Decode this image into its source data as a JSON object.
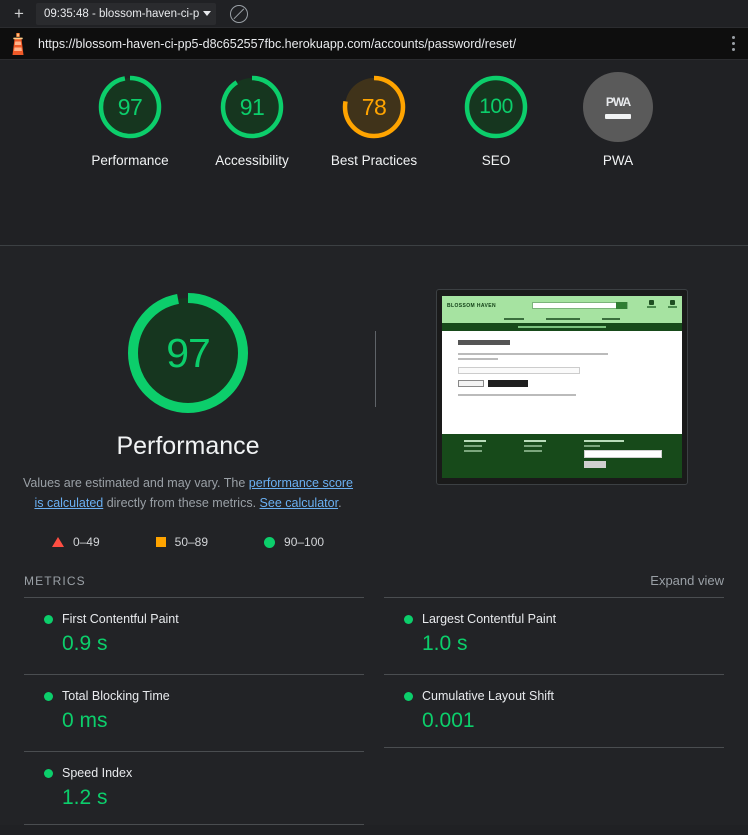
{
  "tabstrip": {
    "new_tab_label": "+",
    "report_tab_label": "09:35:48 - blossom-haven-ci-p",
    "clear_icon": "no-entry-icon"
  },
  "urlbar": {
    "brand_icon": "lighthouse-icon",
    "url": "https://blossom-haven-ci-pp5-d8c652557fbc.herokuapp.com/accounts/password/reset/",
    "menu_icon": "kebab-menu-icon"
  },
  "colors": {
    "pass": "#0cce6b",
    "average": "#ffa400",
    "fail": "#ff4e42",
    "pwa_gray": "#5a5a5a",
    "link": "#6ab0f3",
    "background": "#202124",
    "body_background": "#222326"
  },
  "gauges": [
    {
      "score": "97",
      "label": "Performance",
      "pct": 97,
      "color": "#0cce6b",
      "track": "#16361f"
    },
    {
      "score": "91",
      "label": "Accessibility",
      "pct": 91,
      "color": "#0cce6b",
      "track": "#16361f"
    },
    {
      "score": "78",
      "label": "Best Practices",
      "pct": 78,
      "color": "#ffa400",
      "track": "#40331a"
    },
    {
      "score": "100",
      "label": "SEO",
      "pct": 100,
      "color": "#0cce6b",
      "track": "#16361f"
    },
    {
      "score": "",
      "label": "PWA",
      "pct": 0,
      "color": "#5a5a5a",
      "track": "#5a5a5a"
    }
  ],
  "hero": {
    "score": "97",
    "score_pct": 97,
    "title": "Performance",
    "desc_part1": "Values are estimated and may vary. The ",
    "desc_link1": "performance score is calculated",
    "desc_part2": " directly from these metrics. ",
    "desc_link2": "See calculator",
    "desc_part3": ".",
    "legend": [
      {
        "icon": "triangle-fail-icon",
        "range": "0–49"
      },
      {
        "icon": "square-average-icon",
        "range": "50–89"
      },
      {
        "icon": "circle-pass-icon",
        "range": "90–100"
      }
    ]
  },
  "thumbnail": {
    "name": "page-screenshot-thumbnail",
    "site_name": "BLOSSOM HAVEN",
    "page_heading": "PASSWORD RESET"
  },
  "metrics": {
    "section_title": "METRICS",
    "expand_label": "Expand view",
    "left": [
      {
        "name": "First Contentful Paint",
        "value": "0.9 s",
        "status": "pass"
      },
      {
        "name": "Total Blocking Time",
        "value": "0 ms",
        "status": "pass"
      },
      {
        "name": "Speed Index",
        "value": "1.2 s",
        "status": "pass"
      }
    ],
    "right": [
      {
        "name": "Largest Contentful Paint",
        "value": "1.0 s",
        "status": "pass"
      },
      {
        "name": "Cumulative Layout Shift",
        "value": "0.001",
        "status": "pass"
      }
    ]
  }
}
